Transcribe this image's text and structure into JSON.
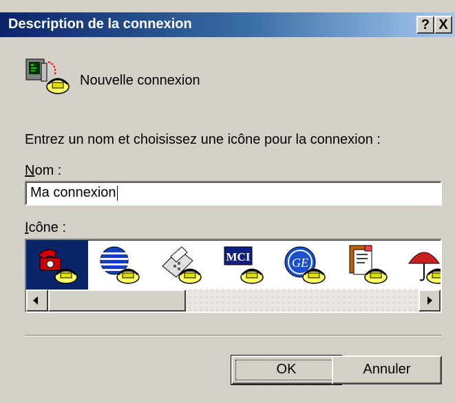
{
  "dialog": {
    "title": "Description de la connexion",
    "help_button": "?",
    "close_button": "X"
  },
  "connection": {
    "icon": "modem-computer-icon",
    "name": "Nouvelle connexion"
  },
  "instructions": "Entrez un nom et choisissez une icône pour la connexion :",
  "name_field": {
    "label_accel": "N",
    "label_rest": "om :",
    "value": "Ma connexion"
  },
  "icon_field": {
    "label_accel": "I",
    "label_rest": "cône :",
    "icons": [
      {
        "name": "red-telephone-icon",
        "selected": true
      },
      {
        "name": "globe-telephone-icon",
        "selected": false
      },
      {
        "name": "fax-machine-icon",
        "selected": false
      },
      {
        "name": "mci-logo-icon",
        "selected": false,
        "text": "MCI"
      },
      {
        "name": "ge-logo-icon",
        "selected": false,
        "text": "GE"
      },
      {
        "name": "documents-icon",
        "selected": false
      },
      {
        "name": "umbrella-icon",
        "selected": false
      }
    ]
  },
  "buttons": {
    "ok": "OK",
    "cancel": "Annuler"
  },
  "colors": {
    "titlebar_start": "#0a246a",
    "titlebar_end": "#a6caf0",
    "dialog_bg": "#d4d0c8",
    "selection": "#0a246a"
  }
}
